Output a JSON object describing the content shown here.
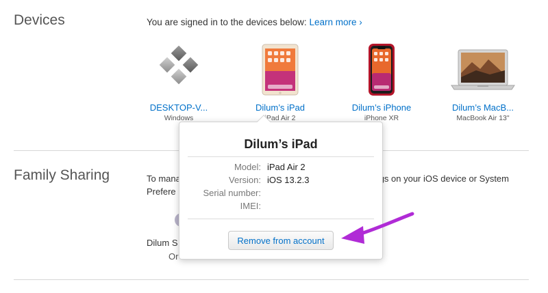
{
  "devices_section": {
    "title": "Devices",
    "intro": "You are signed in to the devices below:",
    "learn_more": "Learn more ›",
    "devices": [
      {
        "name": "DESKTOP-V...",
        "model": "Windows",
        "icon": "windows-logo-icon"
      },
      {
        "name": "Dilum’s iPad",
        "model": "iPad Air 2",
        "icon": "ipad-icon"
      },
      {
        "name": "Dilum’s iPhone",
        "model": "iPhone XR",
        "icon": "iphone-icon"
      },
      {
        "name": "Dilum’s MacB...",
        "model": "MacBook Air 13\"",
        "icon": "macbook-icon"
      }
    ]
  },
  "family_section": {
    "title": "Family Sharing",
    "text_line1_left": "To mana",
    "text_line1_right": "gs on your iOS device or System",
    "text_line2_left": "Prefere",
    "member_name": "Dilum S",
    "member_sub": "Or"
  },
  "popover": {
    "title": "Dilum’s iPad",
    "details": [
      {
        "label": "Model:",
        "value": "iPad Air 2"
      },
      {
        "label": "Version:",
        "value": "iOS 13.2.3"
      },
      {
        "label": "Serial number:",
        "value": ""
      },
      {
        "label": "IMEI:",
        "value": ""
      }
    ],
    "remove_label": "Remove from account"
  },
  "colors": {
    "link": "#0070c9",
    "arrow": "#b02bd6"
  }
}
